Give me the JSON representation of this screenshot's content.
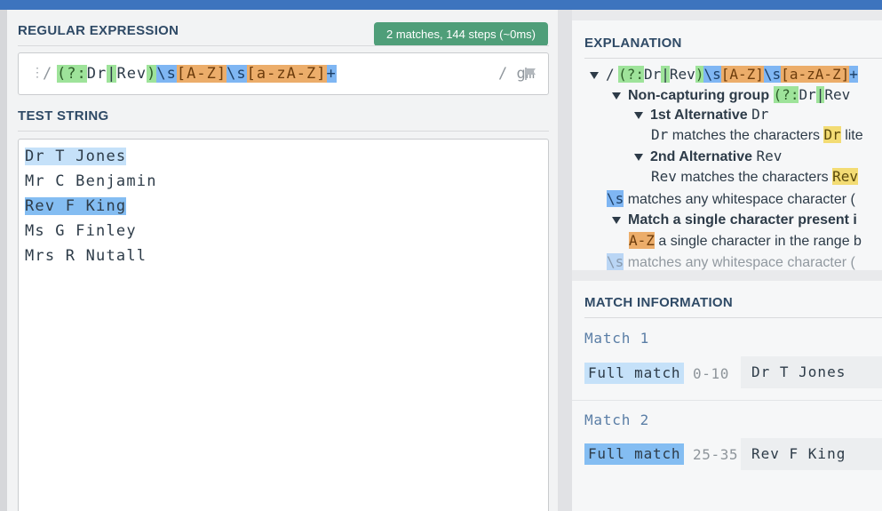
{
  "regex_section": {
    "title": "REGULAR EXPRESSION",
    "badge": "2 matches, 144 steps (~0ms)",
    "delimiter_open": "/",
    "flags": "/ gm",
    "pattern_tokens": [
      {
        "t": "(?:",
        "c": "g"
      },
      {
        "t": "Dr",
        "c": ""
      },
      {
        "t": "|",
        "c": "gt"
      },
      {
        "t": "Rev",
        "c": ""
      },
      {
        "t": ")",
        "c": "g"
      },
      {
        "t": "\\s",
        "c": "b"
      },
      {
        "t": "[",
        "c": "o"
      },
      {
        "t": "A-Z",
        "c": "o"
      },
      {
        "t": "]",
        "c": "o"
      },
      {
        "t": "\\s",
        "c": "b"
      },
      {
        "t": "[",
        "c": "o"
      },
      {
        "t": "a-zA-Z",
        "c": "o"
      },
      {
        "t": "]",
        "c": "o"
      },
      {
        "t": "+",
        "c": "b"
      }
    ]
  },
  "test_section": {
    "title": "TEST STRING",
    "lines": [
      "Dr T Jones",
      "Mr C Benjamin",
      "Rev F King",
      "Ms G Finley",
      "Mrs R Nutall"
    ]
  },
  "explanation": {
    "title": "EXPLANATION",
    "root_slash": "/",
    "group_label": "Non-capturing group",
    "alt1_label": "1st Alternative",
    "alt1_code": "Dr",
    "alt1_desc_code": "Dr",
    "alt1_desc_text": "matches the characters",
    "alt1_desc_lit": "Dr",
    "alt1_desc_tail": "lite",
    "alt2_label": "2nd Alternative",
    "alt2_code": "Rev",
    "alt2_desc_code": "Rev",
    "alt2_desc_text": "matches the characters",
    "alt2_desc_lit": "Rev",
    "ws_token": "\\s",
    "ws_text": "matches any whitespace character (",
    "class_label": "Match a single character present i",
    "class_token": "A-Z",
    "class_text": "a single character in the range b",
    "group_tokens": "(?:",
    "group_tail": "Dr|Rev"
  },
  "match_info": {
    "title": "MATCH INFORMATION",
    "matches": [
      {
        "label": "Match 1",
        "type": "Full match",
        "range": "0-10",
        "value": "Dr T Jones"
      },
      {
        "label": "Match 2",
        "type": "Full match",
        "range": "25-35",
        "value": "Rev F King"
      }
    ]
  },
  "colors": {
    "topbar": "#3d74be",
    "badge": "#4f9e79",
    "group": "#9ee39a",
    "whitespace": "#7fb6f3",
    "charclass": "#ecad6a",
    "literal": "#f3dc74",
    "match1": "#c5e1f9",
    "match2": "#84bdf2"
  }
}
